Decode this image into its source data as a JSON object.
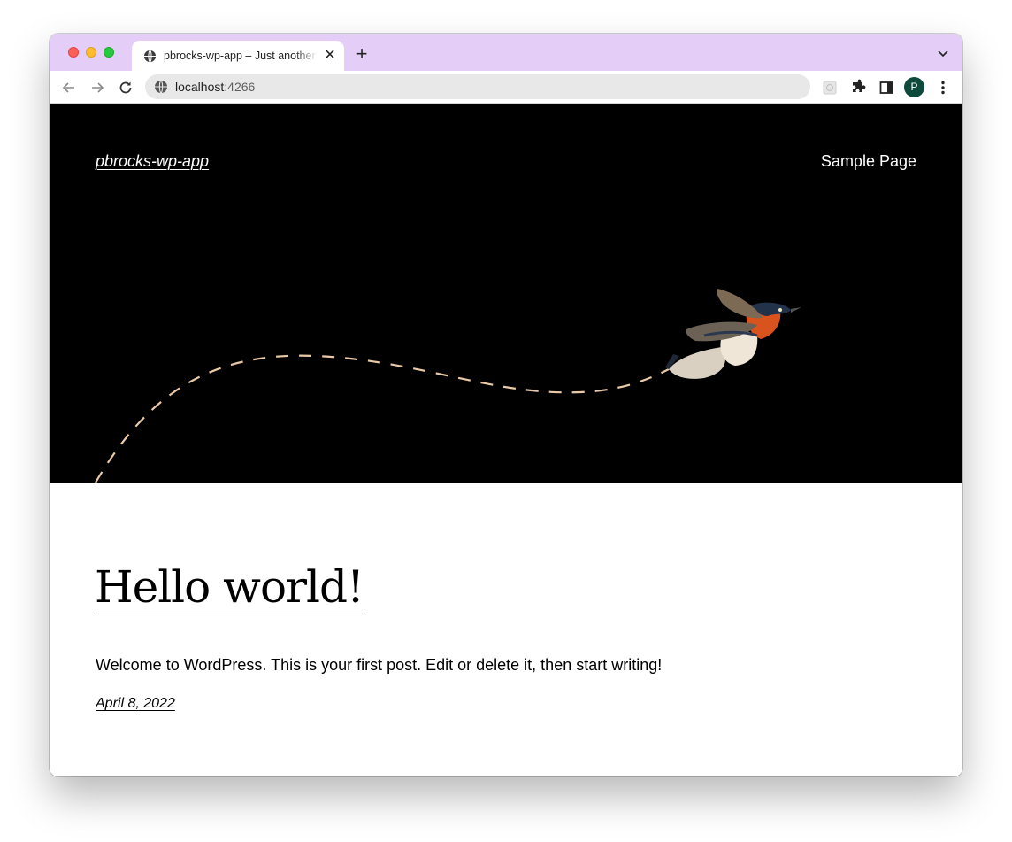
{
  "browser": {
    "tab_title": "pbrocks-wp-app – Just another WordPress site",
    "tab_close_glyph": "✕",
    "new_tab_glyph": "+",
    "url_host": "localhost",
    "url_port": ":4266",
    "profile_initial": "P",
    "profile_color": "#0e4a3c",
    "tabstrip_color": "#e4cdf7",
    "icons": [
      "globe-icon",
      "close-icon",
      "plus-icon",
      "chevron-down-icon",
      "back-arrow-icon",
      "forward-arrow-icon",
      "reload-icon",
      "site-info-icon",
      "extension-icon",
      "puzzle-icon",
      "side-panel-icon",
      "kebab-menu-icon"
    ]
  },
  "site": {
    "title": "pbrocks-wp-app",
    "nav_items": [
      "Sample Page"
    ],
    "header_background": "#000000",
    "path_color": "#e9c9a6"
  },
  "post": {
    "title": "Hello world!",
    "excerpt": "Welcome to WordPress. This is your first post. Edit or delete it, then start writing!",
    "date": "April 8, 2022"
  }
}
